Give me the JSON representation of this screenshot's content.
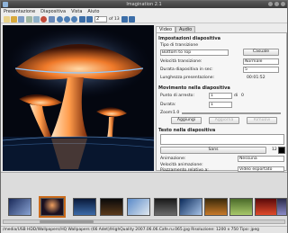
{
  "window": {
    "title": "Imagination 2.1"
  },
  "menu": [
    "Presentazione",
    "Diapositiva",
    "Vista",
    "Aiuto"
  ],
  "toolbar": {
    "slide_number": "2",
    "slide_total": "of 13"
  },
  "tabs": [
    "Video",
    "Audio"
  ],
  "settings": {
    "section_title": "Impostazioni diapositiva",
    "transition_type_label": "Tipo di transizione",
    "transition_value": "Bottom to Top",
    "random_button": "Casuale",
    "transition_speed_label": "Velocità transizione:",
    "transition_speed_value": "Normale",
    "duration_label": "Durata diapositiva in sec:",
    "duration_value": "5",
    "show_length_label": "Lunghezza presentazione:",
    "show_length_value": "00:01:52"
  },
  "motion": {
    "section_title": "Movimento nella diapositiva",
    "stop_point_label": "Punto di arresto:",
    "stop_point_value": "1",
    "stop_point_of": "di",
    "stop_point_total": "0",
    "duration_label": "Durata:",
    "duration_value": "1",
    "zoom_label": "Zoom:",
    "zoom_value": "1.0",
    "add_button": "Aggiungi",
    "update_button": "Aggiorna",
    "remove_button": "Rimuovi"
  },
  "text": {
    "section_title": "Testo nella diapositiva",
    "font_value": "Sans",
    "font_size": "12",
    "animation_label": "Animazione:",
    "animation_value": "Nessuna",
    "anim_speed_label": "Velocità animazione:",
    "placement_label": "Piazzamento relativo a:",
    "placement_value": "Video esportato",
    "subtitle_pos_label": "Posizione sottotitoli:"
  },
  "status": {
    "text": "/media/USB HDD/Wallpapers/HQ Wallpapers (66 Adet)/HighQuality 2007.06.06.Cafe.ru.065.jpg    Risoluzione: 1200 x 750    Tipo: jpeg"
  },
  "thumbs": [
    "t1",
    "t2",
    "t3",
    "t4",
    "t5",
    "t6",
    "t7",
    "t8",
    "t9",
    "t10",
    "t11"
  ]
}
